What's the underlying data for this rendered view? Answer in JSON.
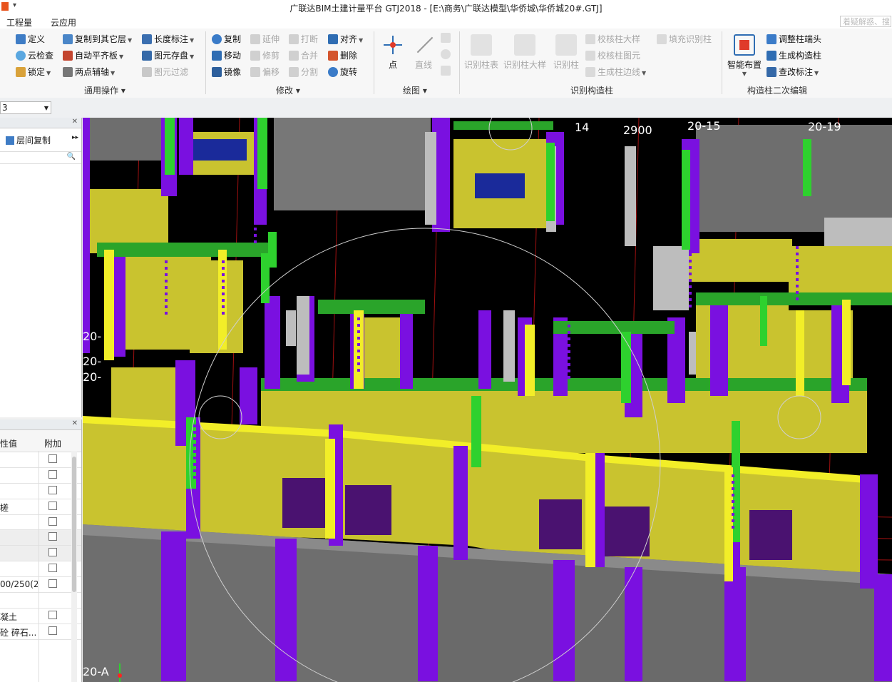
{
  "window": {
    "title": "广联达BIM土建计量平台 GTJ2018 - [E:\\商务\\广联达模型\\华侨城\\华侨城20#.GTJ]"
  },
  "menu": {
    "tabs": [
      "工程量",
      "云应用"
    ],
    "search_placeholder": "着疑解惑、搜"
  },
  "ribbon": {
    "general": {
      "label": "通用操作",
      "items": [
        "定义",
        "云检查",
        "锁定",
        "复制到其它层",
        "自动平齐板",
        "两点辅轴",
        "长度标注",
        "图元存盘",
        "图元过滤"
      ]
    },
    "modify": {
      "label": "修改",
      "items": [
        "复制",
        "移动",
        "镜像",
        "延伸",
        "修剪",
        "偏移",
        "打断",
        "合并",
        "分割",
        "对齐",
        "删除",
        "旋转"
      ]
    },
    "draw": {
      "label": "绘图",
      "items": [
        "点",
        "直线"
      ]
    },
    "identify": {
      "label": "识别构造柱",
      "items": [
        "识别柱表",
        "识别柱大样",
        "识别柱",
        "校核柱大样",
        "校核柱图元",
        "生成柱边线",
        "填充识别柱"
      ]
    },
    "secondary": {
      "label": "构造柱二次编辑",
      "items": [
        "智能布置",
        "调整柱端头",
        "生成构造柱",
        "查改标注"
      ]
    }
  },
  "floor_selector": {
    "value": "3"
  },
  "left_panel_top": {
    "tool": "层间复制"
  },
  "properties_panel": {
    "columns": [
      "性值",
      "附加"
    ],
    "rows": [
      "",
      "",
      "",
      "槎",
      "",
      "",
      "",
      "",
      "00/250(2",
      "",
      "凝土",
      "砼 碎石..."
    ]
  },
  "viewport": {
    "axis_labels_top": [
      "14",
      "2900",
      "20-15",
      "20-19"
    ],
    "axis_labels_left": [
      "20-",
      "20-",
      "20-"
    ],
    "axis_label_bottom": "20-A",
    "colors": {
      "wall_yellow": "#c9c32f",
      "wall_edge_yellow": "#f2ee28",
      "column_purple": "#7a10e0",
      "beam_green": "#2aa42a",
      "green_bright": "#2ed12e",
      "gray_wall": "#6e6e6e",
      "light_gray": "#bdbdbd",
      "window_blue": "#1a2a9a"
    }
  }
}
